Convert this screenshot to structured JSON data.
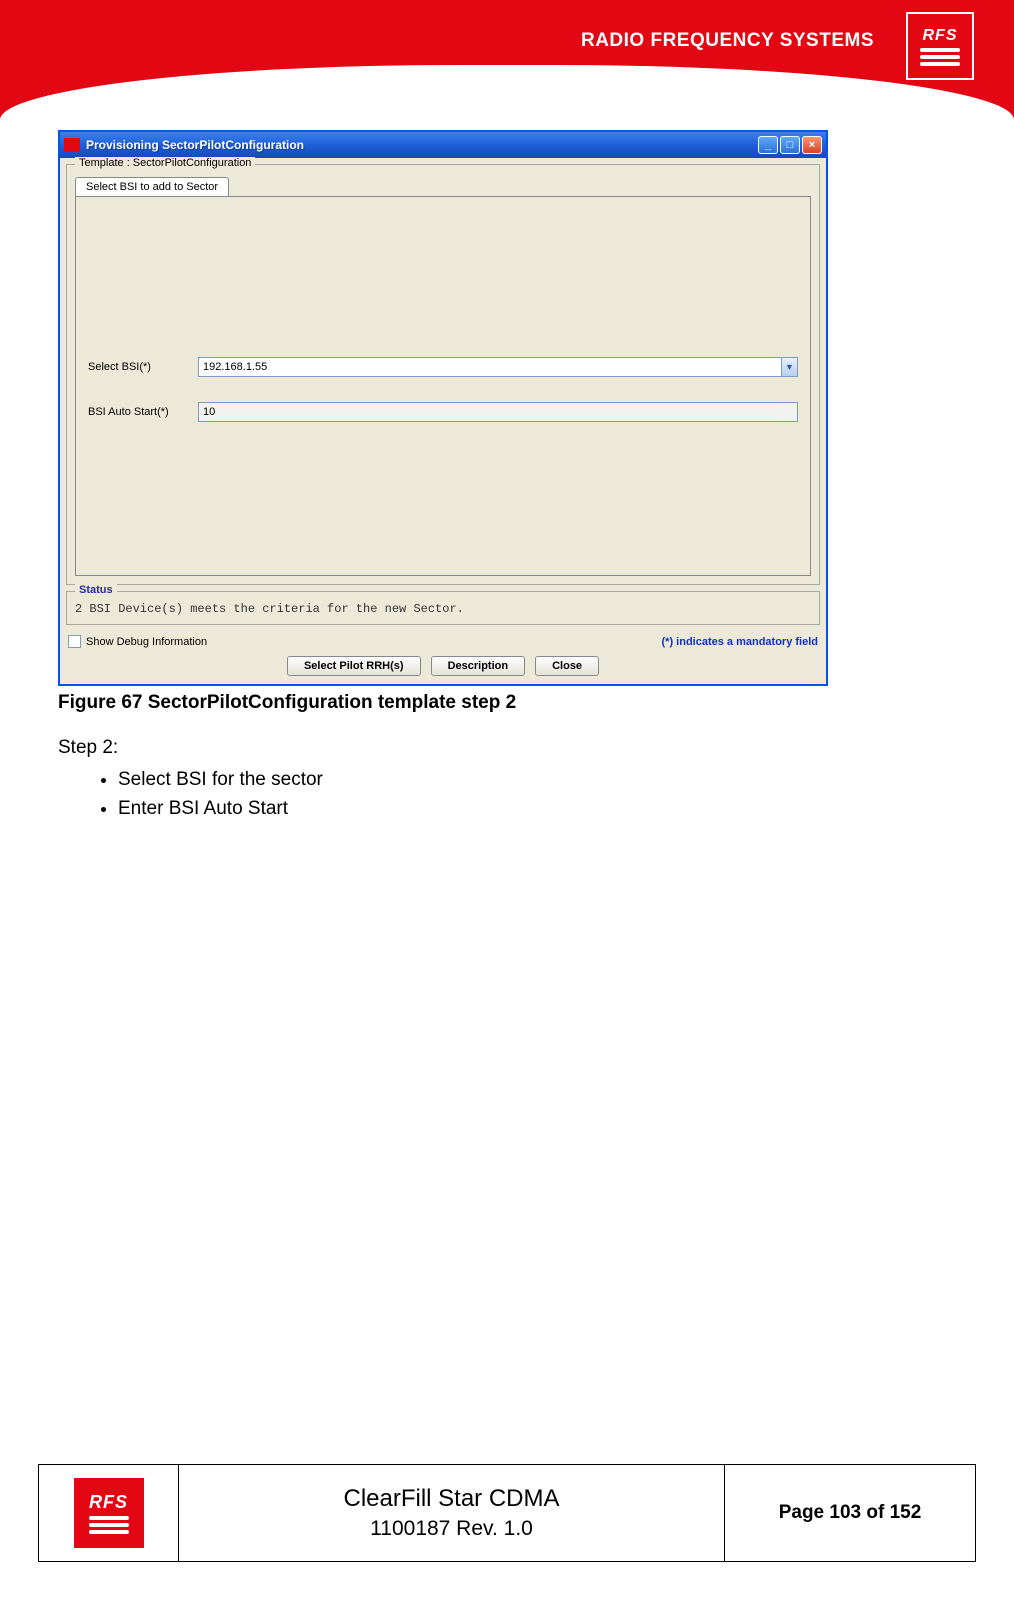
{
  "header": {
    "brand_text": "RADIO FREQUENCY SYSTEMS",
    "logo_text": "RFS"
  },
  "window": {
    "title": "Provisioning SectorPilotConfiguration",
    "template_legend": "Template : SectorPilotConfiguration",
    "tab_label": "Select BSI to add to Sector",
    "fields": {
      "select_bsi_label": "Select BSI(*)",
      "select_bsi_value": "192.168.1.55",
      "bsi_auto_start_label": "BSI Auto Start(*)",
      "bsi_auto_start_value": "10"
    },
    "status_legend": "Status",
    "status_text": "2 BSI Device(s) meets the criteria for the new Sector.",
    "show_debug_label": "Show Debug Information",
    "mandatory_note": "(*) indicates a mandatory field",
    "buttons": {
      "select_pilot": "Select Pilot RRH(s)",
      "description": "Description",
      "close": "Close"
    }
  },
  "caption": "Figure 67 SectorPilotConfiguration template step 2",
  "body": {
    "step_heading": "Step 2:",
    "bullets": [
      "Select BSI for the sector",
      "Enter BSI Auto Start"
    ]
  },
  "footer": {
    "logo_text": "RFS",
    "title": "ClearFill Star CDMA",
    "subtitle": "1100187 Rev. 1.0",
    "page": "Page 103 of 152"
  }
}
